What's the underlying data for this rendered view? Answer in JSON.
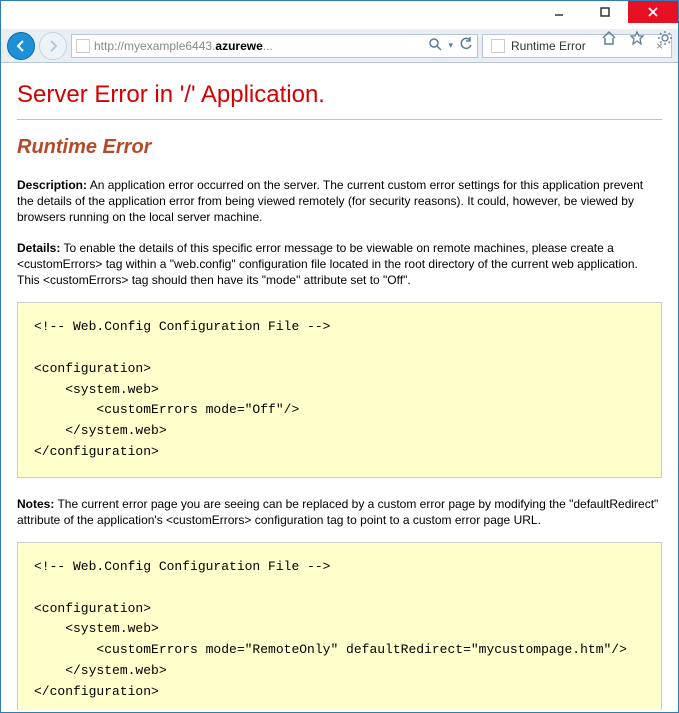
{
  "window": {
    "minimize_label": "minimize",
    "maximize_label": "maximize",
    "close_label": "close"
  },
  "toolbar": {
    "url_prefix": "http://myexample6443.",
    "url_bold": "azurewe",
    "url_suffix": "...",
    "tab_title": "Runtime Error"
  },
  "page": {
    "h1": "Server Error in '/' Application.",
    "h2": "Runtime Error",
    "desc_label": "Description:",
    "desc_text": "An application error occurred on the server. The current custom error settings for this application prevent the details of the application error from being viewed remotely (for security reasons). It could, however, be viewed by browsers running on the local server machine.",
    "details_label": "Details:",
    "details_text": "To enable the details of this specific error message to be viewable on remote machines, please create a <customErrors> tag within a \"web.config\" configuration file located in the root directory of the current web application. This <customErrors> tag should then have its \"mode\" attribute set to \"Off\".",
    "code1": "<!-- Web.Config Configuration File -->\n\n<configuration>\n    <system.web>\n        <customErrors mode=\"Off\"/>\n    </system.web>\n</configuration>",
    "notes_label": "Notes:",
    "notes_text": "The current error page you are seeing can be replaced by a custom error page by modifying the \"defaultRedirect\" attribute of the application's <customErrors> configuration tag to point to a custom error page URL.",
    "code2": "<!-- Web.Config Configuration File -->\n\n<configuration>\n    <system.web>\n        <customErrors mode=\"RemoteOnly\" defaultRedirect=\"mycustompage.htm\"/>\n    </system.web>\n</configuration>"
  }
}
